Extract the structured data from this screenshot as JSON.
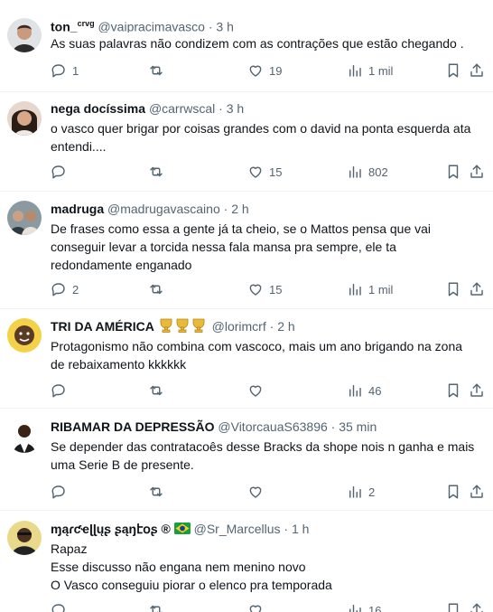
{
  "tweets": [
    {
      "name": "ton_",
      "name_suffix": "crvg",
      "handle": "@vaipracimavasco",
      "time": "3 h",
      "lines": [
        "As suas palavras não condizem com as contrações que estão chegando ."
      ],
      "replies": "1",
      "retweets": "",
      "likes": "19",
      "views": "1 mil"
    },
    {
      "name": "nega docíssima",
      "handle": "@carrwscal",
      "time": "3 h",
      "lines": [
        "o vasco quer brigar por coisas grandes com o david na ponta esquerda ata",
        "entendi...."
      ],
      "replies": "",
      "retweets": "",
      "likes": "15",
      "views": "802"
    },
    {
      "name": "madruga",
      "handle": "@madrugavascaino",
      "time": "2 h",
      "lines": [
        "De frases como essa a gente já ta cheio, se o Mattos pensa que vai",
        "conseguir levar a torcida nessa fala mansa pra sempre, ele ta",
        "redondamente enganado"
      ],
      "replies": "2",
      "retweets": "",
      "likes": "15",
      "views": "1 mil"
    },
    {
      "name": "TRI DA AMÉRICA",
      "name_emoji": "trophy trophy trophy",
      "handle": "@lorimcrf",
      "time": "2 h",
      "lines": [
        "Protagonismo não combina com vascoco, mais um ano brigando na zona",
        "de rebaixamento kkkkkk"
      ],
      "replies": "",
      "retweets": "",
      "likes": "",
      "views": "46"
    },
    {
      "name": "RIBAMAR DA DEPRESSÃO",
      "handle": "@VitorcauaS63896",
      "time": "35 min",
      "lines": [
        "Se depender das contratacoês desse Bracks da shope nois n ganha e mais",
        "uma Serie B de presente."
      ],
      "replies": "",
      "retweets": "",
      "likes": "",
      "views": "2"
    },
    {
      "name": "ɱąɾƈҽɭɭųʂ ʂąŋէօʂ ®",
      "name_emoji": "brazil-flag",
      "handle": "@Sr_Marcellus",
      "time": "1 h",
      "lines": [
        "Rapaz",
        "Esse discusso não engana nem menino novo",
        "O Vasco conseguiu piorar o elenco pra temporada"
      ],
      "replies": "",
      "retweets": "",
      "likes": "",
      "views": "16"
    }
  ],
  "dot": "·",
  "colors": {
    "text": "#0f1419",
    "secondary": "#536471",
    "divider": "#eff3f4"
  },
  "icons": [
    "reply-icon",
    "retweet-icon",
    "like-icon",
    "views-icon",
    "bookmark-icon",
    "share-icon",
    "trophy-icon",
    "brazil-flag-icon"
  ]
}
